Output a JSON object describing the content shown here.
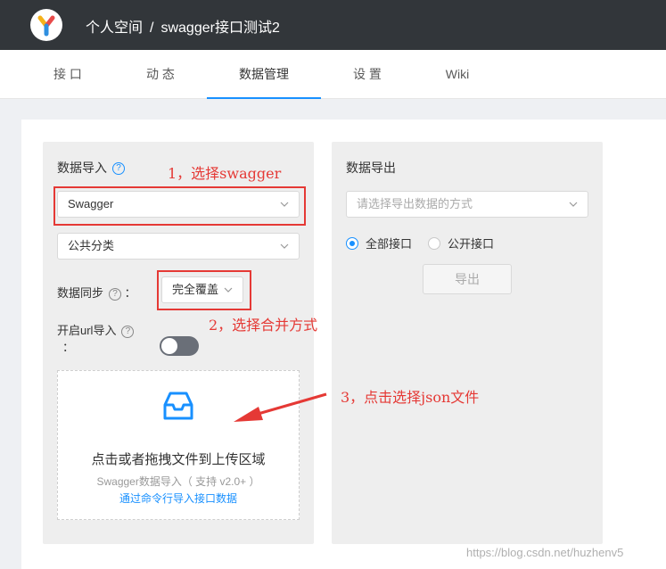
{
  "header": {
    "breadcrumb_space": "个人空间",
    "separator": "/",
    "project": "swagger接口测试2"
  },
  "tabs": [
    {
      "label": "接 口"
    },
    {
      "label": "动 态"
    },
    {
      "label": "数据管理"
    },
    {
      "label": "设 置"
    },
    {
      "label": "Wiki"
    }
  ],
  "active_tab": "数据管理",
  "import_panel": {
    "title": "数据导入",
    "type_select": "Swagger",
    "category_select": "公共分类",
    "sync_label": "数据同步",
    "sync_select": "完全覆盖",
    "url_import_label": "开启url导入",
    "colon": "：",
    "url_import_enabled": false,
    "dropzone_text": "点击或者拖拽文件到上传区域",
    "dropzone_hint": "Swagger数据导入（ 支持 v2.0+ ）",
    "dropzone_link": "通过命令行导入接口数据"
  },
  "export_panel": {
    "title": "数据导出",
    "method_placeholder": "请选择导出数据的方式",
    "radio_all": "全部接口",
    "radio_public": "公开接口",
    "selected": "全部接口",
    "export_button": "导出"
  },
  "annotations": {
    "step1": "1，选择swagger",
    "step2": "2，选择合并方式",
    "step3": "3，点击选择json文件"
  },
  "watermark": "https://blog.csdn.net/huzhenv5",
  "colors": {
    "topbar": "#32363a",
    "accent": "#1890ff",
    "annotation_red": "#e53935"
  },
  "icons": {
    "logo": "yapi-logo",
    "chevron": "chevron-down-icon",
    "help": "question-circle-icon",
    "upload": "inbox-icon"
  }
}
